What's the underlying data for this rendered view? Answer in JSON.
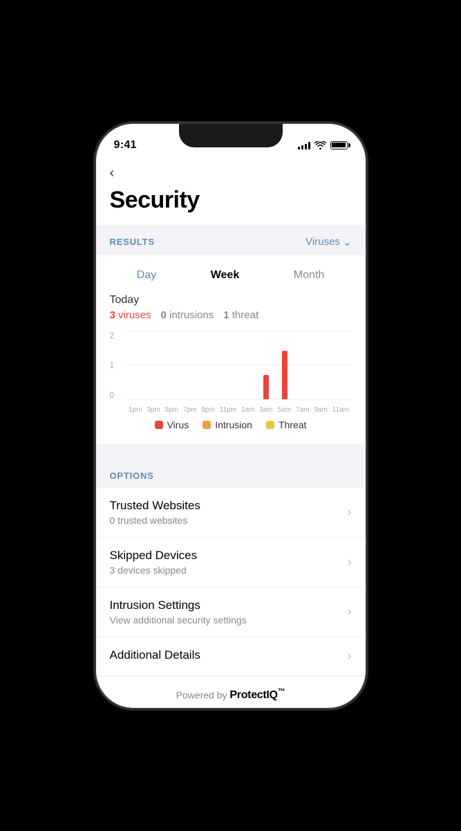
{
  "status_bar": {
    "time": "9:41"
  },
  "header": {
    "back_label": "<",
    "title": "Security"
  },
  "results": {
    "section_label": "RESULTS",
    "filter_label": "Viruses",
    "time_tabs": [
      {
        "label": "Day",
        "active": false
      },
      {
        "label": "Week",
        "active": true
      },
      {
        "label": "Month",
        "active": false
      }
    ],
    "today_label": "Today",
    "stats": {
      "viruses_count": "3",
      "viruses_label": "viruses",
      "intrusions_count": "0",
      "intrusions_label": "intrusions",
      "threat_count": "1",
      "threat_label": "threat"
    },
    "chart": {
      "y_labels": [
        "2",
        "1",
        "0"
      ],
      "x_labels": [
        "1pm",
        "3pm",
        "5pm",
        "7pm",
        "9pm",
        "11pm",
        "1am",
        "3am",
        "5am",
        "7am",
        "9am",
        "11am"
      ],
      "bars": [
        {
          "virus": 0,
          "intrusion": 0,
          "threat": 0
        },
        {
          "virus": 0,
          "intrusion": 0,
          "threat": 0
        },
        {
          "virus": 0,
          "intrusion": 0,
          "threat": 0
        },
        {
          "virus": 0,
          "intrusion": 0,
          "threat": 0
        },
        {
          "virus": 0,
          "intrusion": 0,
          "threat": 0
        },
        {
          "virus": 0,
          "intrusion": 0,
          "threat": 0
        },
        {
          "virus": 0,
          "intrusion": 0,
          "threat": 0
        },
        {
          "virus": 35,
          "intrusion": 0,
          "threat": 0
        },
        {
          "virus": 75,
          "intrusion": 0,
          "threat": 0
        },
        {
          "virus": 0,
          "intrusion": 0,
          "threat": 0
        },
        {
          "virus": 0,
          "intrusion": 0,
          "threat": 0
        },
        {
          "virus": 0,
          "intrusion": 0,
          "threat": 0
        }
      ]
    },
    "legend": [
      {
        "label": "Virus",
        "type": "virus"
      },
      {
        "label": "Intrusion",
        "type": "intrusion"
      },
      {
        "label": "Threat",
        "type": "threat"
      }
    ]
  },
  "options": {
    "section_label": "OPTIONS",
    "items": [
      {
        "title": "Trusted Websites",
        "subtitle": "0 trusted websites"
      },
      {
        "title": "Skipped Devices",
        "subtitle": "3 devices skipped"
      },
      {
        "title": "Intrusion Settings",
        "subtitle": "View additional security settings"
      },
      {
        "title": "Additional Details",
        "subtitle": ""
      }
    ]
  },
  "footer": {
    "powered_by": "Powered by",
    "brand": "ProtectIQ",
    "tm": "™"
  }
}
